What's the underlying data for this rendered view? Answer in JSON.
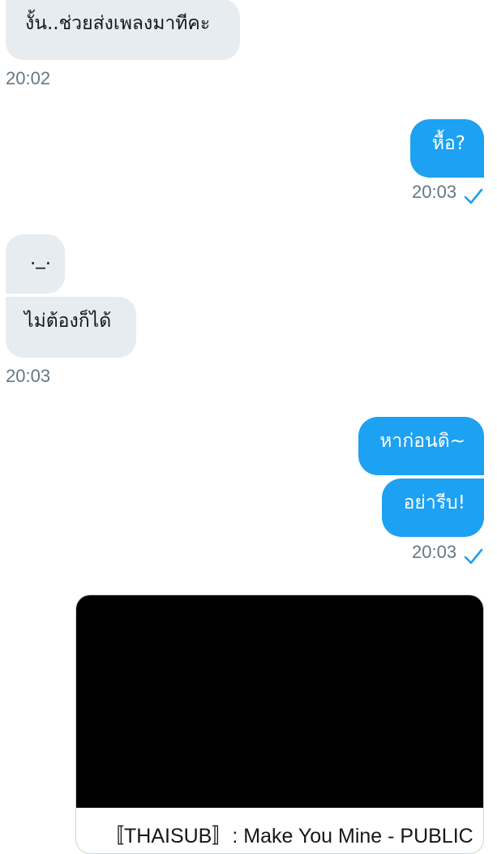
{
  "messages": [
    {
      "text": "งั้น..ช่วยส่งเพลงมาทีคะ"
    },
    {
      "text": "20:02"
    },
    {
      "text": "หื้อ?"
    },
    {
      "text": "20:03"
    },
    {
      "text": "._."
    },
    {
      "text": "ไม่ต้องก็ได้"
    },
    {
      "text": "20:03"
    },
    {
      "text": "หาก่อนดิ~"
    },
    {
      "text": "อย่ารีบ!"
    },
    {
      "text": "20:03"
    }
  ],
  "card": {
    "title": "〚THAISUB〛: Make You Mine - PUBLIC"
  },
  "colors": {
    "incoming_bubble": "#e6ecf0",
    "outgoing_bubble": "#1da1f2",
    "timestamp": "#657786",
    "read_check": "#1da1f2",
    "media_background": "#000000"
  },
  "icons": {
    "read_receipt": "checkmark-icon"
  }
}
